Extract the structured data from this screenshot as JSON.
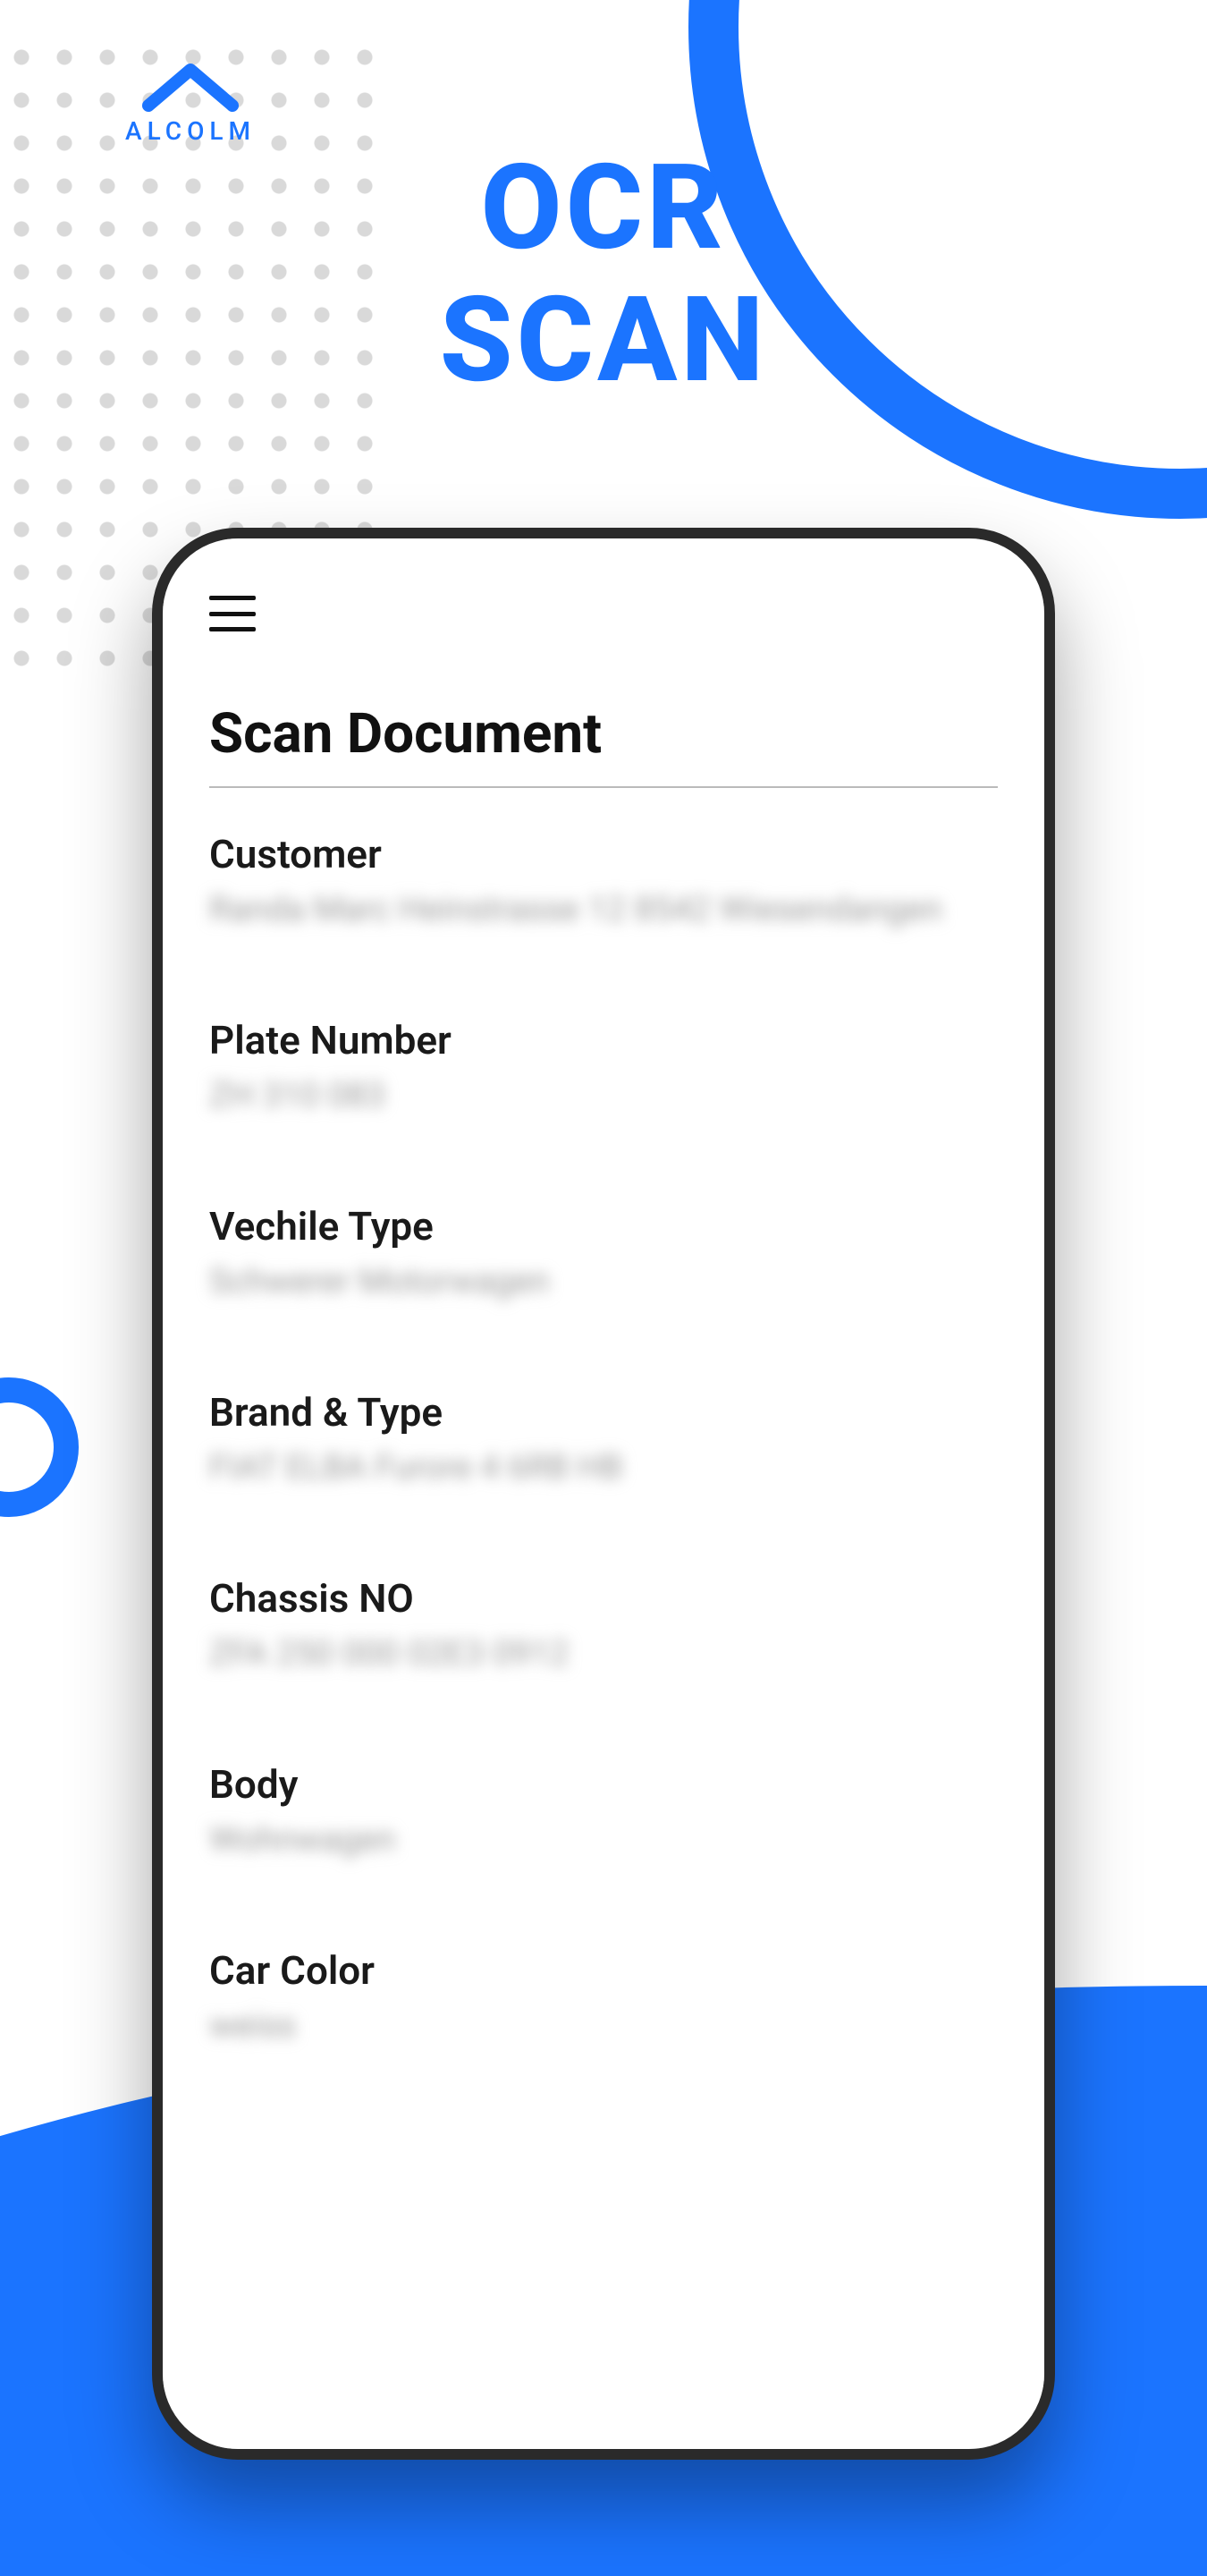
{
  "brand": {
    "name": "ALCOLM"
  },
  "promo": {
    "title": "OCR\nSCAN"
  },
  "screen": {
    "page_title": "Scan Document",
    "fields": [
      {
        "label": "Customer",
        "value": "Randa Marc Heinstrasse 12 8542 Wiesendangen"
      },
      {
        "label": "Plate Number",
        "value": "ZH 310 083"
      },
      {
        "label": "Vechile Type",
        "value": "Schwerer Motorwagen"
      },
      {
        "label": "Brand & Type",
        "value": "FIAT ELBA Furore 4 6RB HB"
      },
      {
        "label": "Chassis NO",
        "value": "ZFA 250 000 02E3 0912"
      },
      {
        "label": "Body",
        "value": "Wohnwagen"
      },
      {
        "label": "Car Color",
        "value": "weiss"
      }
    ]
  }
}
